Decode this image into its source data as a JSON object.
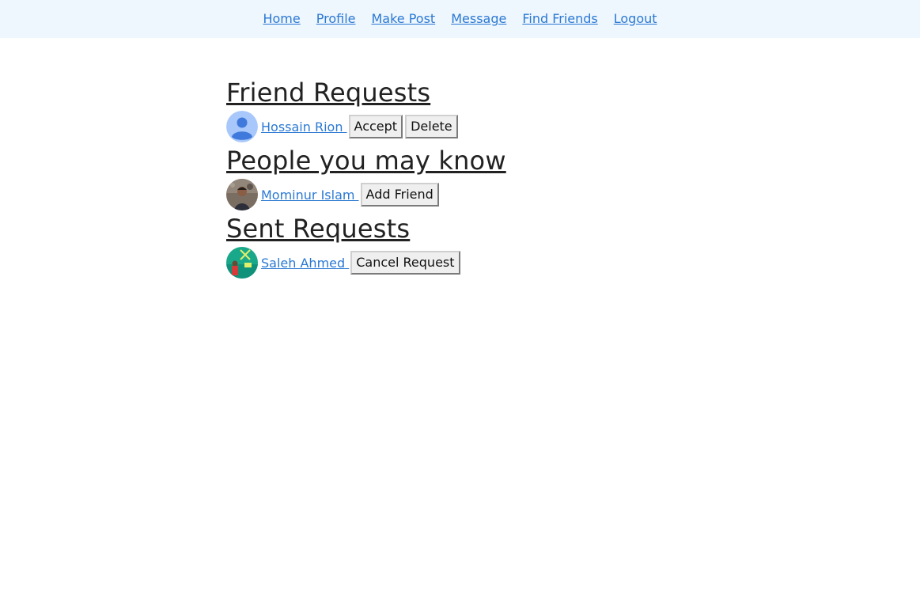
{
  "nav": {
    "home": "Home",
    "profile": "Profile",
    "make_post": "Make Post",
    "message": "Message",
    "find_friends": "Find Friends",
    "logout": "Logout"
  },
  "friend_requests": {
    "title": "Friend Requests",
    "items": [
      {
        "name": "Hossain Rion ",
        "accept_label": "Accept",
        "delete_label": "Delete"
      }
    ]
  },
  "people_you_may_know": {
    "title": "People you may know",
    "items": [
      {
        "name": "Mominur Islam ",
        "add_label": "Add Friend"
      }
    ]
  },
  "sent_requests": {
    "title": "Sent Requests",
    "items": [
      {
        "name": "Saleh Ahmed ",
        "cancel_label": "Cancel Request"
      }
    ]
  },
  "colors": {
    "nav_background": "#eef6fe",
    "link": "#2b79d3",
    "button_background": "#efefef"
  }
}
